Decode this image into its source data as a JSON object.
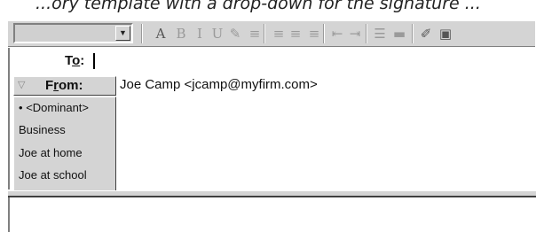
{
  "caption": {
    "text": "...ory template with a drop-down for the signature ..."
  },
  "toolbar": {
    "font_combo": {
      "value": "",
      "arrow": "▼"
    },
    "icons": [
      {
        "name": "font-size-icon",
        "glyph": "A"
      },
      {
        "name": "bold-icon",
        "glyph": "B"
      },
      {
        "name": "italic-icon",
        "glyph": "I"
      },
      {
        "name": "underline-icon",
        "glyph": "U"
      },
      {
        "name": "color-icon",
        "glyph": "✎"
      },
      {
        "name": "strikethrough-icon",
        "glyph": "≡"
      },
      {
        "name": "align-left-icon",
        "glyph": "≡"
      },
      {
        "name": "align-center-icon",
        "glyph": "≡"
      },
      {
        "name": "align-right-icon",
        "glyph": "≡"
      },
      {
        "name": "decrease-indent-icon",
        "glyph": "⇤"
      },
      {
        "name": "increase-indent-icon",
        "glyph": "⇥"
      },
      {
        "name": "bullets-icon",
        "glyph": "☰"
      },
      {
        "name": "insert-line-icon",
        "glyph": "▬"
      },
      {
        "name": "signature-icon",
        "glyph": "✐"
      },
      {
        "name": "template-icon",
        "glyph": "▣"
      }
    ]
  },
  "header": {
    "to_label_prefix": "T",
    "to_label_underlined": "o",
    "to_label_suffix": ":",
    "from_label_prefix": "F",
    "from_label_underlined": "r",
    "from_label_suffix": "om:",
    "from_value": "Joe Camp <jcamp@myfirm.com>"
  },
  "from_menu": {
    "items": [
      {
        "label": "<Dominant>",
        "selected": true
      },
      {
        "label": "Business",
        "selected": false
      },
      {
        "label": "Joe at home",
        "selected": false
      },
      {
        "label": "Joe at school",
        "selected": false
      }
    ],
    "bullet": "•"
  }
}
